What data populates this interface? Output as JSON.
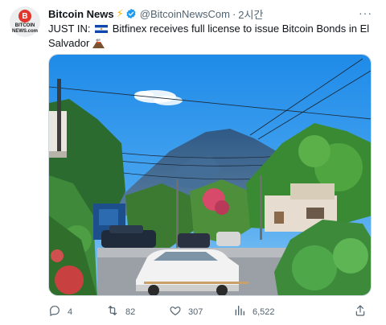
{
  "tweet": {
    "author_name": "Bitcoin News",
    "handle": "@BitcoinNewsCom",
    "separator": "·",
    "time": "2시간",
    "avatar_text_line1": "BITCOIN",
    "avatar_text_line2": "NEWS.com",
    "avatar_coin": "B",
    "text_prefix": "JUST IN:",
    "text_body": "Bitfinex receives full license to issue Bitcoin Bonds in El Salvador",
    "more_label": "···"
  },
  "actions": {
    "replies": "4",
    "retweets": "82",
    "likes": "307",
    "views": "6,522"
  },
  "colors": {
    "verified": "#1d9bf0",
    "bolt": "#f7b500",
    "secondary_text": "#536471"
  },
  "icons": [
    "bitcoin-news-avatar",
    "lightning-icon",
    "verified-badge-icon",
    "more-icon",
    "el-salvador-flag-icon",
    "volcano-icon",
    "reply-icon",
    "retweet-icon",
    "like-icon",
    "views-icon",
    "share-icon"
  ]
}
